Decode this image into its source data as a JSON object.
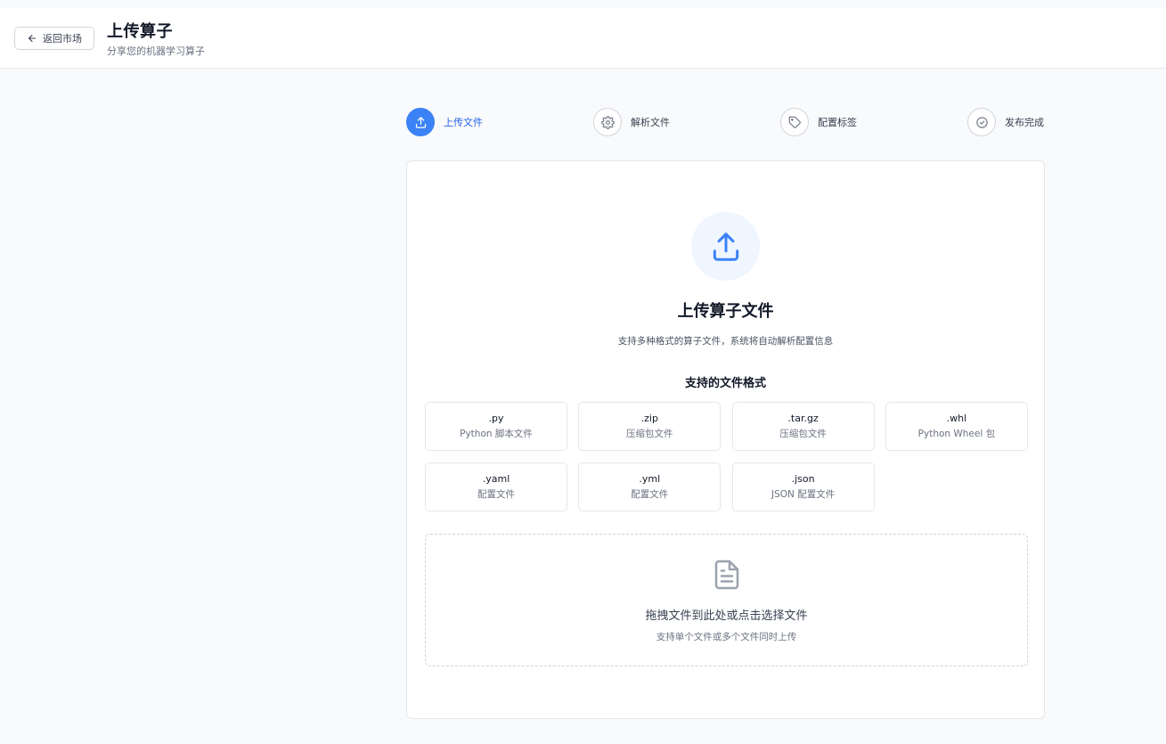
{
  "header": {
    "back_label": "返回市场",
    "title": "上传算子",
    "subtitle": "分享您的机器学习算子"
  },
  "steps": [
    {
      "label": "上传文件",
      "icon": "upload-icon",
      "active": true
    },
    {
      "label": "解析文件",
      "icon": "gear-icon",
      "active": false
    },
    {
      "label": "配置标签",
      "icon": "tag-icon",
      "active": false
    },
    {
      "label": "发布完成",
      "icon": "check-circle-icon",
      "active": false
    }
  ],
  "upload": {
    "title": "上传算子文件",
    "description": "支持多种格式的算子文件，系统将自动解析配置信息",
    "formats_title": "支持的文件格式",
    "formats": [
      {
        "ext": ".py",
        "name": "Python 脚本文件"
      },
      {
        "ext": ".zip",
        "name": "压缩包文件"
      },
      {
        "ext": ".tar.gz",
        "name": "压缩包文件"
      },
      {
        "ext": ".whl",
        "name": "Python Wheel 包"
      },
      {
        "ext": ".yaml",
        "name": "配置文件"
      },
      {
        "ext": ".yml",
        "name": "配置文件"
      },
      {
        "ext": ".json",
        "name": "JSON 配置文件"
      }
    ],
    "dropzone": {
      "text": "拖拽文件到此处或点击选择文件",
      "hint": "支持单个文件或多个文件同时上传"
    }
  },
  "colors": {
    "accent": "#3b82f6",
    "accent_text": "#2563eb",
    "hero_bg": "#eff6ff"
  }
}
